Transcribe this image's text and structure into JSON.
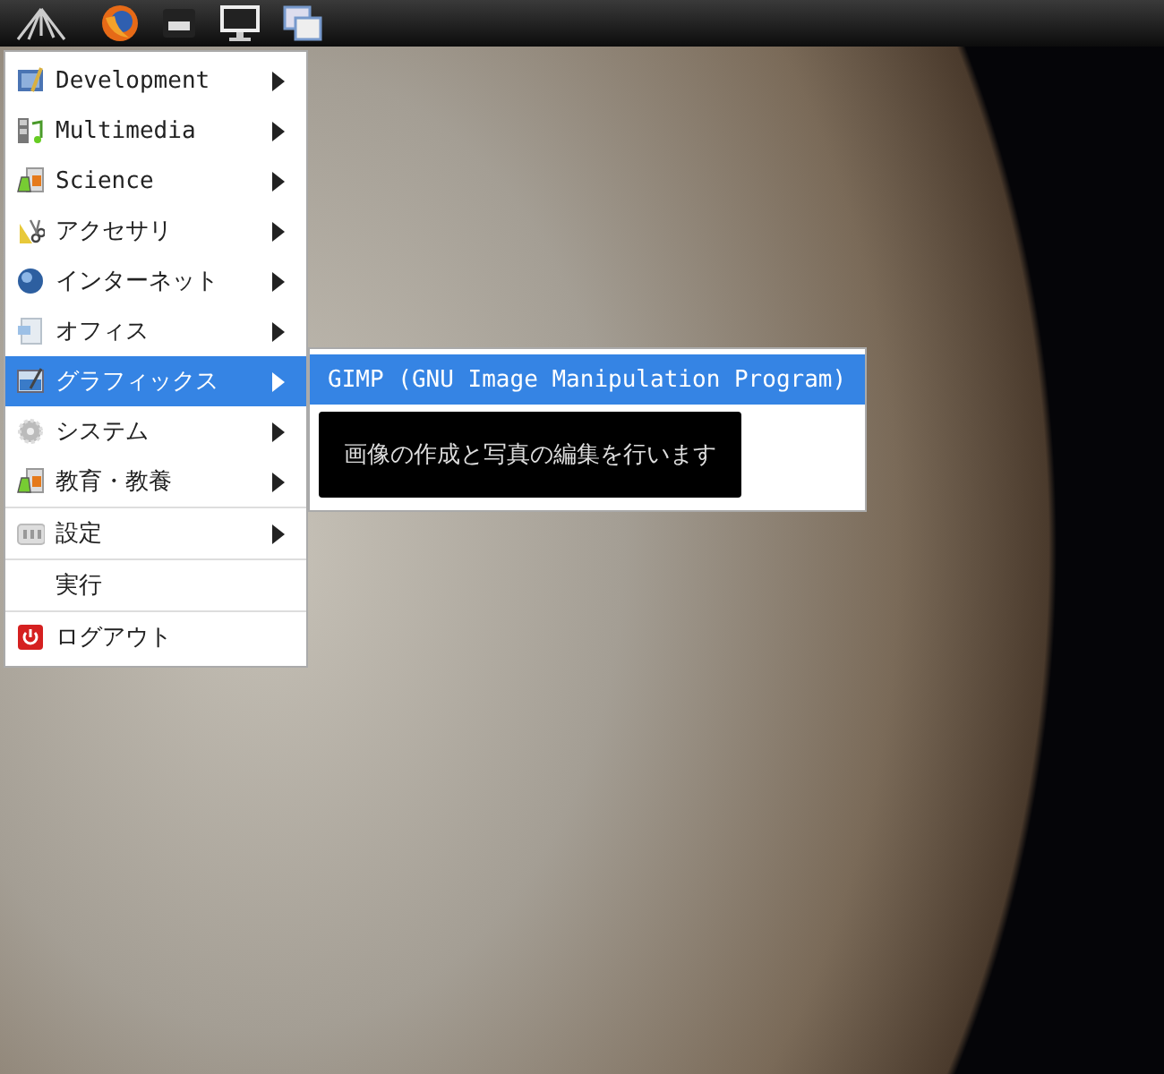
{
  "menu": {
    "sections": [
      [
        {
          "label": "Development",
          "kind": "submenu",
          "selected": false
        },
        {
          "label": "Multimedia",
          "kind": "submenu",
          "selected": false
        },
        {
          "label": "Science",
          "kind": "submenu",
          "selected": false
        },
        {
          "label": "アクセサリ",
          "kind": "submenu",
          "selected": false
        },
        {
          "label": "インターネット",
          "kind": "submenu",
          "selected": false
        },
        {
          "label": "オフィス",
          "kind": "submenu",
          "selected": false
        },
        {
          "label": "グラフィックス",
          "kind": "submenu",
          "selected": true
        },
        {
          "label": "システム",
          "kind": "submenu",
          "selected": false
        },
        {
          "label": "教育・教養",
          "kind": "submenu",
          "selected": false
        }
      ],
      [
        {
          "label": "設定",
          "kind": "submenu",
          "selected": false
        }
      ],
      [
        {
          "label": "実行",
          "kind": "command",
          "selected": false
        }
      ],
      [
        {
          "label": "ログアウト",
          "kind": "command",
          "selected": false
        }
      ]
    ]
  },
  "submenu": {
    "items": [
      {
        "label": "GIMP (GNU Image Manipulation Program)",
        "selected": true
      }
    ]
  },
  "tooltip": {
    "text": "画像の作成と写真の編集を行います"
  }
}
